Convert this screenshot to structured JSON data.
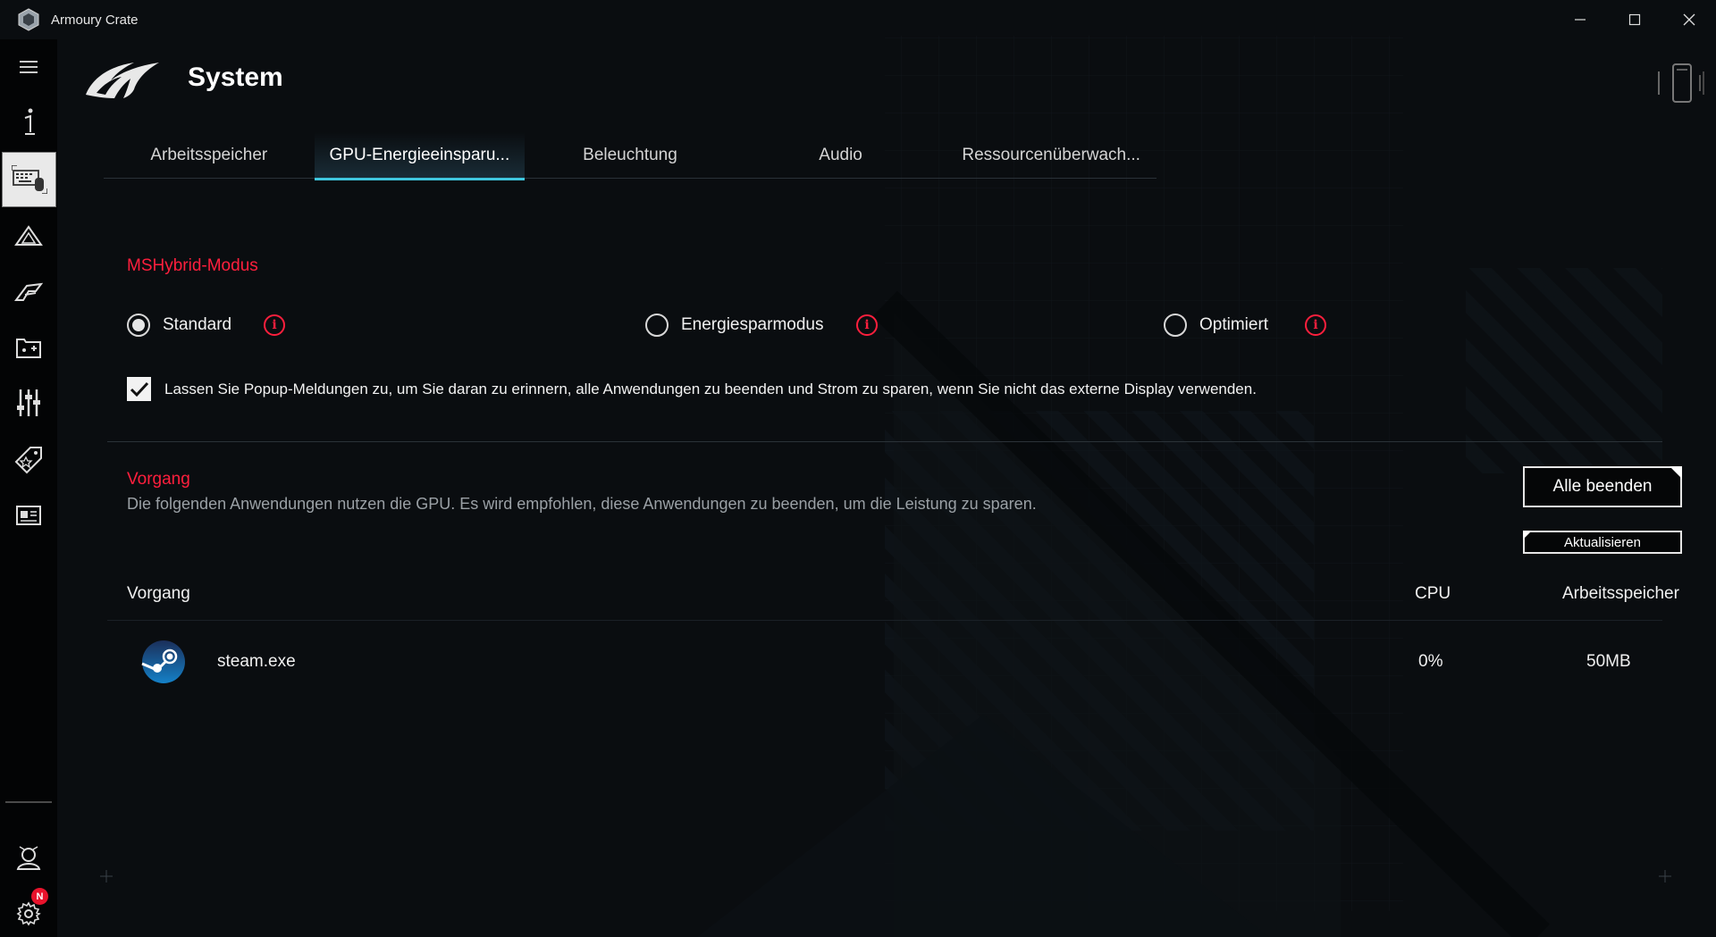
{
  "window": {
    "title": "Armoury Crate",
    "controls": [
      "minimize",
      "maximize",
      "close"
    ]
  },
  "sidebar": {
    "items": [
      {
        "name": "menu-icon"
      },
      {
        "name": "info-icon"
      },
      {
        "name": "device-keyboard-icon",
        "active": true
      },
      {
        "name": "gamevisual-icon"
      },
      {
        "name": "aura-sync-icon"
      },
      {
        "name": "game-library-icon"
      },
      {
        "name": "scenario-profiles-icon"
      },
      {
        "name": "deals-icon"
      },
      {
        "name": "news-icon"
      }
    ],
    "bottom": [
      {
        "name": "user-center-icon"
      },
      {
        "name": "settings-icon",
        "badge": "N"
      }
    ]
  },
  "header": {
    "title": "System"
  },
  "tabs": [
    {
      "label": "Arbeitsspeicher",
      "active": false
    },
    {
      "label": "GPU-Energieeinsparu...",
      "active": true
    },
    {
      "label": "Beleuchtung",
      "active": false
    },
    {
      "label": "Audio",
      "active": false
    },
    {
      "label": "Ressourcenüberwach...",
      "active": false
    }
  ],
  "mshybrid": {
    "title": "MSHybrid-Modus",
    "options": [
      {
        "label": "Standard",
        "checked": true
      },
      {
        "label": "Energiesparmodus",
        "checked": false
      },
      {
        "label": "Optimiert",
        "checked": false
      }
    ],
    "info_glyph": "i",
    "popup_checkbox": {
      "checked": true,
      "label": "Lassen Sie Popup-Meldungen zu, um Sie daran zu erinnern, alle Anwendungen zu beenden und Strom zu sparen, wenn Sie nicht das externe Display verwenden."
    }
  },
  "process": {
    "title": "Vorgang",
    "description": "Die folgenden Anwendungen nutzen die GPU. Es wird empfohlen, diese Anwendungen zu beenden, um die Leistung zu sparen.",
    "end_all_button": "Alle beenden",
    "refresh_button": "Aktualisieren",
    "columns": {
      "process": "Vorgang",
      "cpu": "CPU",
      "memory": "Arbeitsspeicher"
    },
    "rows": [
      {
        "icon": "steam-icon",
        "name": "steam.exe",
        "cpu": "0%",
        "memory": "50MB"
      }
    ]
  },
  "colors": {
    "accent_red": "#ff1f3d",
    "tab_underline": "#3fc6de",
    "background": "#0a0d10"
  }
}
